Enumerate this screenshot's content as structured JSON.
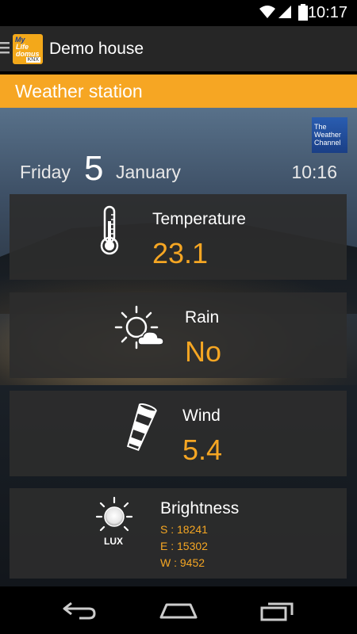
{
  "status_bar": {
    "time": "10:17"
  },
  "action_bar": {
    "app_title": "Demo house",
    "logo": {
      "line1": "My",
      "line2": "Life",
      "line3": "domus",
      "badge": "KNX"
    }
  },
  "section": {
    "title": "Weather station"
  },
  "provider_logo": {
    "line1": "The",
    "line2": "Weather",
    "line3": "Channel"
  },
  "date": {
    "weekday": "Friday",
    "day": "5",
    "month": "January",
    "time": "10:16"
  },
  "cards": {
    "temperature": {
      "label": "Temperature",
      "value": "23.1",
      "icon": "thermometer-icon"
    },
    "rain": {
      "label": "Rain",
      "value": "No",
      "icon": "sun-cloud-icon"
    },
    "wind": {
      "label": "Wind",
      "value": "5.4",
      "icon": "windsock-icon"
    },
    "brightness": {
      "label": "Brightness",
      "icon_text": "LUX",
      "south": "S : 18241",
      "east": "E : 15302",
      "west": "W : 9452"
    }
  },
  "colors": {
    "accent": "#f5a623",
    "header": "#f6a623",
    "card": "#2d2d2d"
  }
}
